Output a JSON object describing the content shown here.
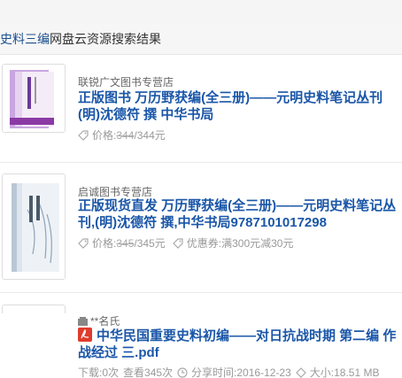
{
  "header": {
    "keyword": "史料三编",
    "suffix": "网盘云资源搜索结果"
  },
  "results": [
    {
      "shop": "联锐广文图书专营店",
      "title": "正版图书 万历野获编(全三册)——元明史料笔记丛刊(明)沈德符 撰 中华书局",
      "price_label": "价格:",
      "price_old": "344",
      "price_sep": "/",
      "price_now": "344元"
    },
    {
      "shop": "启诚图书专营店",
      "title": "正版现货直发 万历野获编(全三册)——元明史料笔记丛刊,(明)沈德符 撰,中华书局9787101017298",
      "price_label": "价格:",
      "price_old": "345",
      "price_sep": "/",
      "price_now": "345元",
      "coupon_label": "优惠券:",
      "coupon_value": "满300元减30元"
    },
    {
      "user": "**名氏",
      "title": "中华民国重要史料初编——对日抗战时期 第二编 作战经过 三.pdf",
      "downloads": "下载:0次",
      "views": "查看345次",
      "share_time": "分享时间:2016-12-23",
      "size": "大小:18.51 MB"
    }
  ],
  "colors": {
    "link": "#1a56a8",
    "pdf": "#e03b2c"
  }
}
